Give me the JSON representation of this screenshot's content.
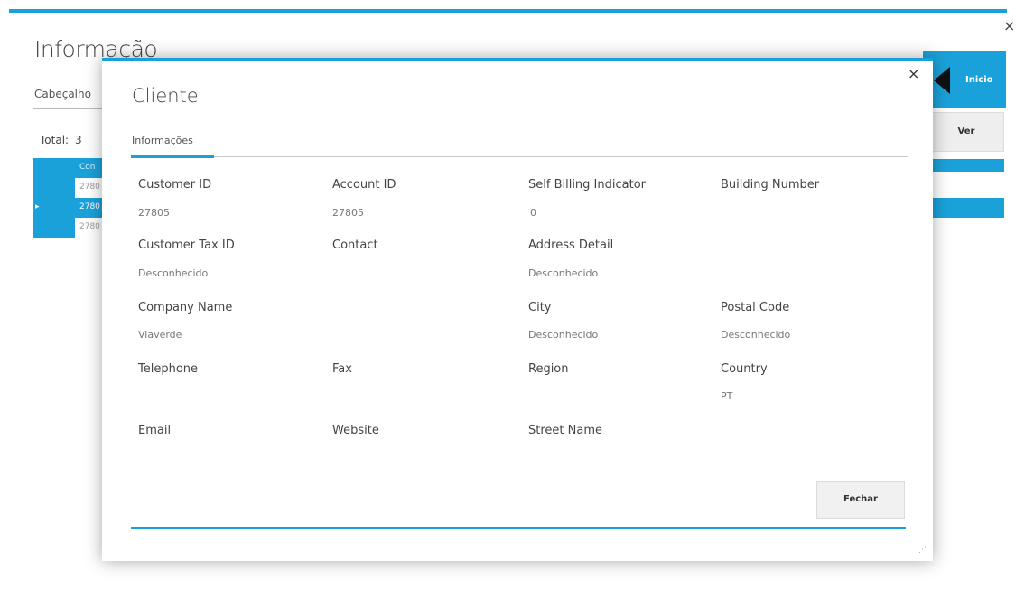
{
  "background": {
    "title": "Informação",
    "close_glyph": "×",
    "tab_label": "Cabeçalho",
    "total_label": "Total:",
    "total_value": "3",
    "grid": {
      "header_text": "Con",
      "rows": [
        "2780",
        "2780",
        "2780"
      ],
      "selected_row_index": 1,
      "row_indicator": "▸"
    },
    "inicio_label": "Inicio",
    "ver_label": "Ver"
  },
  "modal": {
    "title": "Cliente",
    "close_glyph": "×",
    "tab_label": "Informações",
    "fields": {
      "customer_id": {
        "label": "Customer ID",
        "value": "27805"
      },
      "account_id": {
        "label": "Account ID",
        "value": "27805"
      },
      "self_billing": {
        "label": "Self Billing Indicator",
        "value": "0"
      },
      "building_number": {
        "label": "Building Number",
        "value": ""
      },
      "customer_tax_id": {
        "label": "Customer Tax ID",
        "value": "Desconhecido"
      },
      "contact": {
        "label": "Contact",
        "value": ""
      },
      "address_detail": {
        "label": "Address Detail",
        "value": "Desconhecido"
      },
      "company_name": {
        "label": "Company Name",
        "value": "Viaverde"
      },
      "city": {
        "label": "City",
        "value": "Desconhecido"
      },
      "postal_code": {
        "label": "Postal Code",
        "value": "Desconhecido"
      },
      "telephone": {
        "label": "Telephone",
        "value": ""
      },
      "fax": {
        "label": "Fax",
        "value": ""
      },
      "region": {
        "label": "Region",
        "value": ""
      },
      "country": {
        "label": "Country",
        "value": "PT"
      },
      "email": {
        "label": "Email",
        "value": ""
      },
      "website": {
        "label": "Website",
        "value": ""
      },
      "street_name": {
        "label": "Street Name",
        "value": ""
      }
    },
    "close_button_label": "Fechar",
    "resize_glyph": "⋰"
  },
  "colors": {
    "accent": "#1ba1d9",
    "button_bg": "#f1f1f1"
  }
}
